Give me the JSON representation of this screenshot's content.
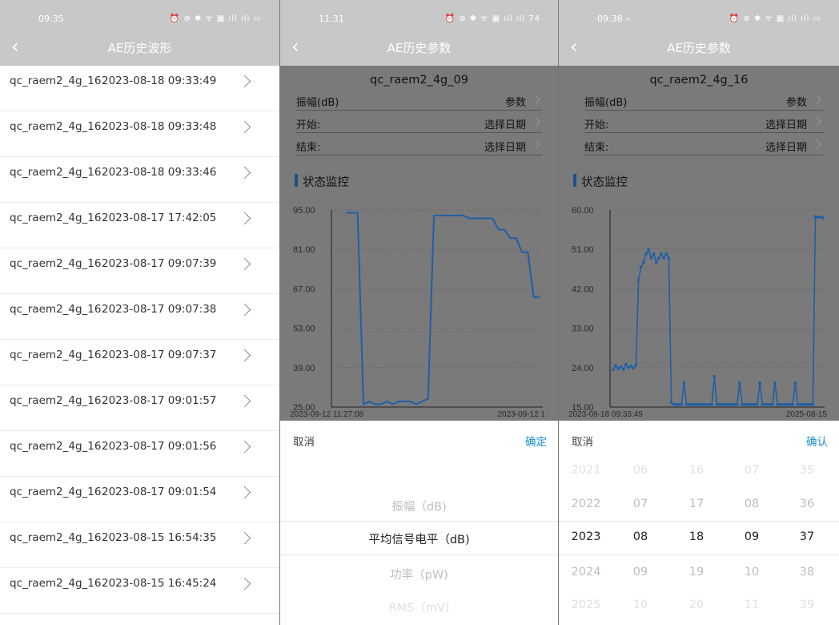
{
  "panel1": {
    "status_time": "09:35",
    "status_icons": "⏰ ⊕ ✱ ᯤ ▦ ıll ıll ▭",
    "title": "AE历史波形",
    "rows": [
      {
        "device": "qc_raem2_4g_16",
        "time": "2023-08-18 09:33:49"
      },
      {
        "device": "qc_raem2_4g_16",
        "time": "2023-08-18 09:33:48"
      },
      {
        "device": "qc_raem2_4g_16",
        "time": "2023-08-18 09:33:46"
      },
      {
        "device": "qc_raem2_4g_16",
        "time": "2023-08-17 17:42:05"
      },
      {
        "device": "qc_raem2_4g_16",
        "time": "2023-08-17 09:07:39"
      },
      {
        "device": "qc_raem2_4g_16",
        "time": "2023-08-17 09:07:38"
      },
      {
        "device": "qc_raem2_4g_16",
        "time": "2023-08-17 09:07:37"
      },
      {
        "device": "qc_raem2_4g_16",
        "time": "2023-08-17 09:01:57"
      },
      {
        "device": "qc_raem2_4g_16",
        "time": "2023-08-17 09:01:56"
      },
      {
        "device": "qc_raem2_4g_16",
        "time": "2023-08-17 09:01:54"
      },
      {
        "device": "qc_raem2_4g_16",
        "time": "2023-08-15 16:54:35"
      },
      {
        "device": "qc_raem2_4g_16",
        "time": "2023-08-15 16:45:24"
      }
    ]
  },
  "panel2": {
    "status_time": "11:31",
    "status_icons": "⏰ ⊕ ✱ ᯤ ▦ ıll ıll 74",
    "title": "AE历史参数",
    "device": "qc_raem2_4g_09",
    "params": [
      {
        "label": "振幅(dB)",
        "value": "参数"
      },
      {
        "label": "开始:",
        "value": "选择日期"
      },
      {
        "label": "结束:",
        "value": "选择日期"
      }
    ],
    "section": "状态监控",
    "cancel": "取消",
    "confirm": "确定",
    "options": [
      "振幅（dB)",
      "平均信号电平（dB)",
      "功率（pW)",
      "RMS（mV)"
    ]
  },
  "panel3": {
    "status_time": "09:38",
    "status_extra": "⌕",
    "status_icons": "⏰ ⊕ ✱ ᯤ ▦ ıll ıll ▭",
    "title": "AE历史参数",
    "device": "qc_raem2_4g_16",
    "params": [
      {
        "label": "振幅(dB)",
        "value": "参数"
      },
      {
        "label": "开始:",
        "value": "选择日期"
      },
      {
        "label": "结束:",
        "value": "选择日期"
      }
    ],
    "section": "状态监控",
    "cancel": "取消",
    "confirm": "确认",
    "picker": {
      "year": [
        "2021",
        "2022",
        "2023",
        "2024",
        "2025"
      ],
      "month": [
        "06",
        "07",
        "08",
        "09",
        "10"
      ],
      "day": [
        "16",
        "17",
        "18",
        "19",
        "20"
      ],
      "hour": [
        "07",
        "08",
        "09",
        "10",
        "11"
      ],
      "minute": [
        "35",
        "36",
        "37",
        "38",
        "39"
      ]
    }
  },
  "chart_data": [
    {
      "type": "line",
      "yticks": [
        "95.00",
        "81.00",
        "67.00",
        "53.00",
        "39.00",
        "25.00"
      ],
      "ylim": [
        25,
        95
      ],
      "x_start_label": "2023-09-12 11:27:08",
      "x_end_label": "2023-09-12 1",
      "values": [
        94,
        94,
        94,
        26,
        27,
        26,
        26,
        27,
        26,
        27,
        27,
        27,
        26,
        27,
        28,
        93,
        93,
        93,
        93,
        93,
        93,
        92,
        92,
        92,
        92,
        92,
        88,
        88,
        85,
        85,
        80,
        80,
        64,
        64
      ],
      "color": "#1f5fa8"
    },
    {
      "type": "line",
      "yticks": [
        "60.00",
        "51.00",
        "42.00",
        "33.00",
        "24.00",
        "15.00"
      ],
      "ylim": [
        15,
        60
      ],
      "x_start_label": "2023-08-18 09:33:49",
      "x_end_label": "2025-08-15",
      "color": "#1f5fa8"
    }
  ]
}
